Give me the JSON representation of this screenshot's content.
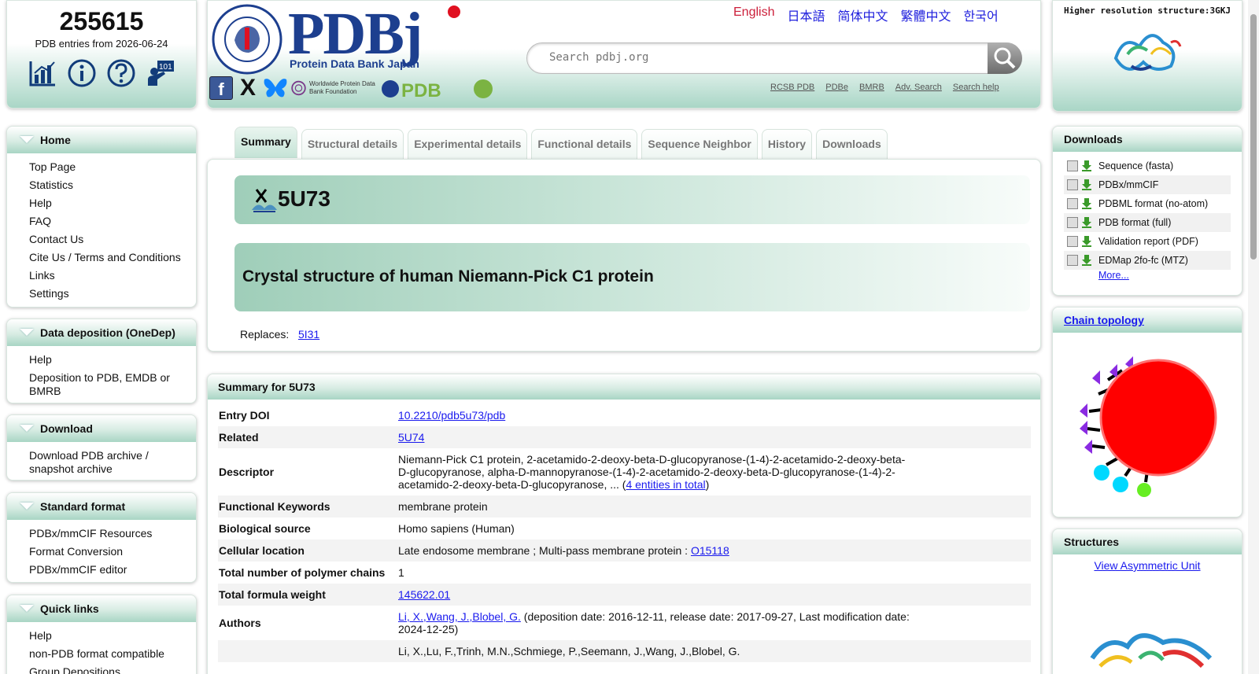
{
  "counter": {
    "value": "255615",
    "label": "PDB entries from 2026-06-24"
  },
  "counter_icons": [
    "statistics-icon",
    "info-icon",
    "help-icon",
    "tutorial-icon"
  ],
  "logo": {
    "text": "PDBj",
    "subtitle": "Protein Data Bank Japan",
    "seal_text": "PROTEIN DATA BANK JAPAN · THE UNIVERSITY OF OSAKA"
  },
  "social": {
    "wwpdb_foundation": "Worldwide Protein Data Bank Foundation",
    "wwpdb": "WORLDWIDE PROTEIN DATA BANK"
  },
  "languages": [
    {
      "label": "English",
      "active": true
    },
    {
      "label": "日本語"
    },
    {
      "label": "简体中文"
    },
    {
      "label": "繁體中文"
    },
    {
      "label": "한국어"
    }
  ],
  "search": {
    "placeholder": "Search pdbj.org"
  },
  "quick_links": [
    "RCSB PDB",
    "PDBe",
    "BMRB",
    "Adv. Search",
    "Search help"
  ],
  "hires": {
    "label": "Higher resolution structure:3GKJ"
  },
  "menus": [
    {
      "title": "Home",
      "items": [
        "Top Page",
        "Statistics",
        "Help",
        "FAQ",
        "Contact Us",
        "Cite Us / Terms and Conditions",
        "Links",
        "Settings"
      ]
    },
    {
      "title": "Data deposition (OneDep)",
      "items": [
        "Help",
        "Deposition to PDB, EMDB or BMRB"
      ]
    },
    {
      "title": "Download",
      "items": [
        "Download PDB archive / snapshot archive"
      ]
    },
    {
      "title": "Standard format",
      "items": [
        "PDBx/mmCIF Resources",
        "Format Conversion",
        "PDBx/mmCIF editor"
      ]
    },
    {
      "title": "Quick links",
      "items": [
        "Help",
        "non-PDB format compatible",
        "Group Depositions"
      ]
    }
  ],
  "tabs": [
    "Summary",
    "Structural details",
    "Experimental details",
    "Functional details",
    "Sequence Neighbor",
    "History",
    "Downloads"
  ],
  "entry": {
    "id": "5U73",
    "title": "Crystal structure of human Niemann-Pick C1 protein",
    "replaces_label": "Replaces:",
    "replaces": "5I31"
  },
  "summary": {
    "title": "Summary for 5U73",
    "rows": [
      {
        "key": "Entry DOI",
        "value": "",
        "link": "10.2210/pdb5u73/pdb"
      },
      {
        "key": "Related",
        "value": "",
        "link": "5U74"
      },
      {
        "key": "Descriptor",
        "value": "Niemann-Pick C1 protein, 2-acetamido-2-deoxy-beta-D-glucopyranose-(1-4)-2-acetamido-2-deoxy-beta-D-glucopyranose, alpha-D-mannopyranose-(1-4)-2-acetamido-2-deoxy-beta-D-glucopyranose-(1-4)-2-acetamido-2-deoxy-beta-D-glucopyranose, ... (",
        "link": "4 entities in total",
        "suffix": ")"
      },
      {
        "key": "Functional Keywords",
        "value": "membrane protein"
      },
      {
        "key": "Biological source",
        "value": "Homo sapiens (Human)"
      },
      {
        "key": "Cellular location",
        "value": "Late endosome membrane ; Multi-pass membrane protein : ",
        "link": "O15118"
      },
      {
        "key": "Total number of polymer chains",
        "value": "1"
      },
      {
        "key": "Total formula weight",
        "value": "",
        "link": "145622.01"
      },
      {
        "key": "Authors",
        "value": "",
        "link": "Li, X.,Wang, J.,Blobel, G.",
        "suffix": " (deposition date: 2016-12-11, release date: 2017-09-27, Last modification date: 2024-12-25)"
      },
      {
        "key": "",
        "value": "Li, X.,Lu, F.,Trinh, M.N.,Schmiege, P.,Seemann, J.,Wang, J.,Blobel, G."
      }
    ]
  },
  "downloads": {
    "title": "Downloads",
    "items": [
      "Sequence (fasta)",
      "PDBx/mmCIF",
      "PDBML format (no-atom)",
      "PDB format (full)",
      "Validation report (PDF)",
      "EDMap 2fo-fc (MTZ)"
    ],
    "more": "More..."
  },
  "chain_topology": {
    "title": "Chain topology"
  },
  "structures": {
    "title": "Structures",
    "link": "View Asymmetric Unit"
  }
}
